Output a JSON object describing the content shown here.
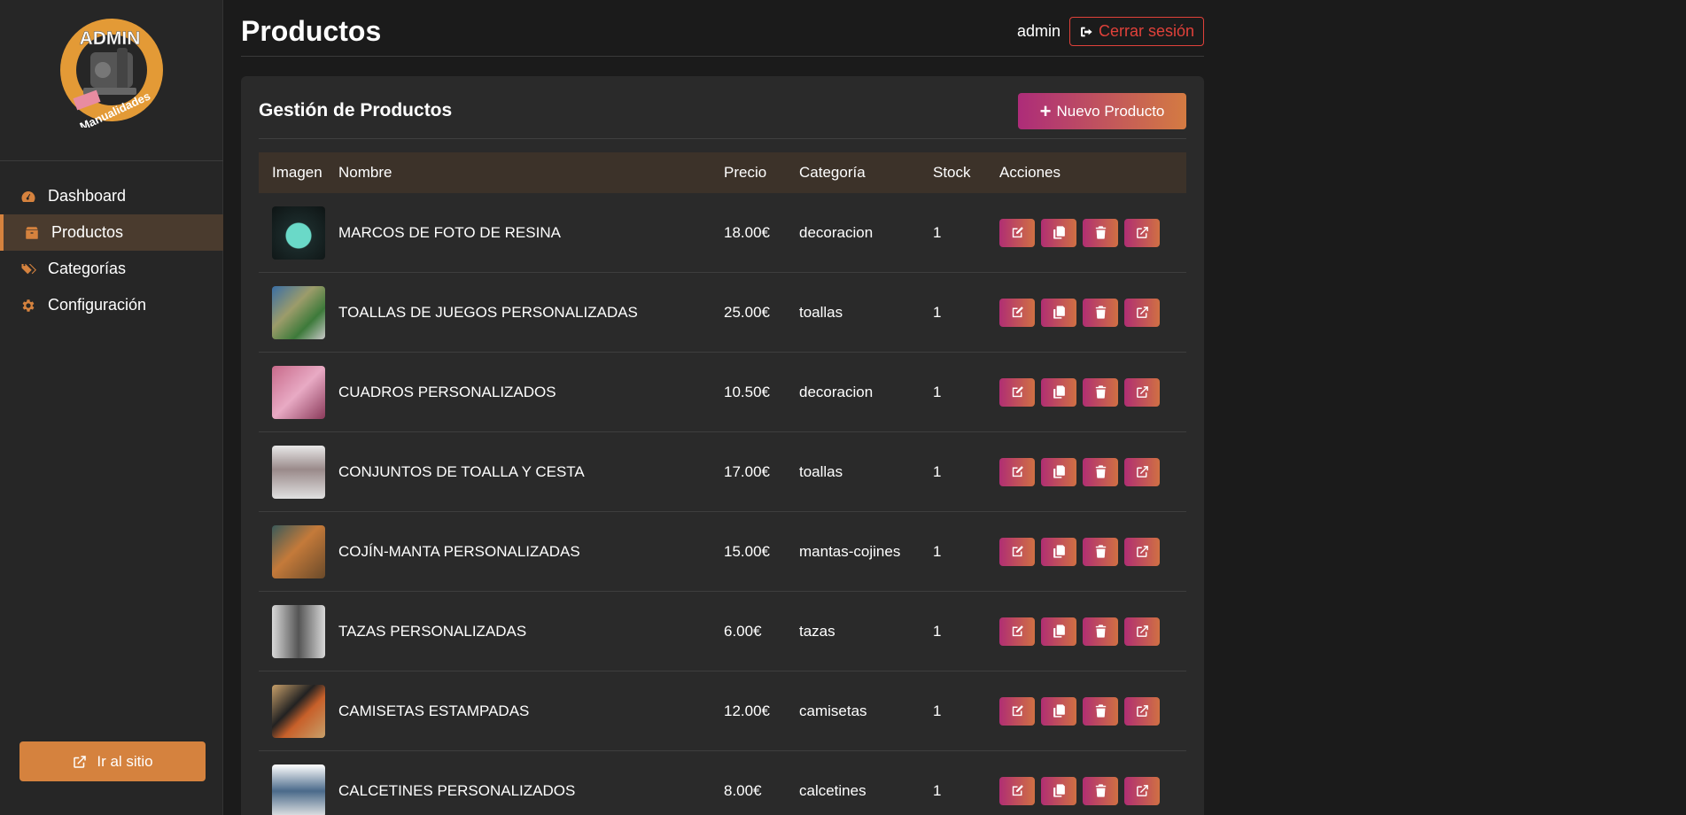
{
  "sidebar": {
    "logo": {
      "top_text": "ADMIN",
      "ring_text": "Manualidades"
    },
    "items": [
      {
        "label": "Dashboard",
        "icon": "gauge-icon"
      },
      {
        "label": "Productos",
        "icon": "box-icon",
        "active": true
      },
      {
        "label": "Categorías",
        "icon": "tags-icon"
      },
      {
        "label": "Configuración",
        "icon": "gear-icon"
      }
    ],
    "site_button": "Ir al sitio"
  },
  "header": {
    "title": "Productos",
    "user": "admin",
    "logout_label": "Cerrar sesión"
  },
  "card": {
    "title": "Gestión de Productos",
    "new_button": "Nuevo Producto"
  },
  "table": {
    "headers": [
      "Imagen",
      "Nombre",
      "Precio",
      "Categoría",
      "Stock",
      "Acciones"
    ],
    "rows": [
      {
        "name": "MARCOS DE FOTO DE RESINA",
        "price": "18.00€",
        "category": "decoracion",
        "stock": "1"
      },
      {
        "name": "TOALLAS DE JUEGOS PERSONALIZADAS",
        "price": "25.00€",
        "category": "toallas",
        "stock": "1"
      },
      {
        "name": "CUADROS PERSONALIZADOS",
        "price": "10.50€",
        "category": "decoracion",
        "stock": "1"
      },
      {
        "name": "CONJUNTOS DE TOALLA Y CESTA",
        "price": "17.00€",
        "category": "toallas",
        "stock": "1"
      },
      {
        "name": "COJÍN-MANTA PERSONALIZADAS",
        "price": "15.00€",
        "category": "mantas-cojines",
        "stock": "1"
      },
      {
        "name": "TAZAS PERSONALIZADAS",
        "price": "6.00€",
        "category": "tazas",
        "stock": "1"
      },
      {
        "name": "CAMISETAS ESTAMPADAS",
        "price": "12.00€",
        "category": "camisetas",
        "stock": "1"
      },
      {
        "name": "CALCETINES PERSONALIZADOS",
        "price": "8.00€",
        "category": "calcetines",
        "stock": "1"
      }
    ]
  },
  "colors": {
    "accent_orange": "#d5823e",
    "accent_gradient_start": "#ad2c79",
    "accent_gradient_end": "#d47b42",
    "logout_red": "#e0413a",
    "sidebar_bg": "#262626",
    "page_bg": "#1b1b1b",
    "card_bg": "#2a2a2a",
    "table_header_bg": "#3c3229"
  }
}
